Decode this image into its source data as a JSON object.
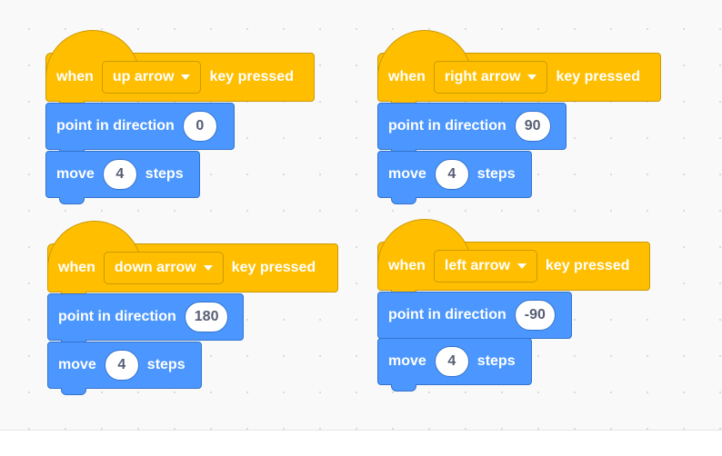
{
  "colors": {
    "events": "#ffbf00",
    "events_border": "#cc9900",
    "motion": "#4c97ff",
    "motion_border": "#3373cc",
    "reporter_text": "#575e75"
  },
  "scripts": [
    {
      "hat": {
        "when": "when",
        "key": "up arrow",
        "suffix": "key pressed"
      },
      "point": {
        "label": "point in direction",
        "value": "0"
      },
      "move": {
        "label": "move",
        "value": "4",
        "suffix": "steps"
      }
    },
    {
      "hat": {
        "when": "when",
        "key": "right arrow",
        "suffix": "key pressed"
      },
      "point": {
        "label": "point in direction",
        "value": "90"
      },
      "move": {
        "label": "move",
        "value": "4",
        "suffix": "steps"
      }
    },
    {
      "hat": {
        "when": "when",
        "key": "down arrow",
        "suffix": "key pressed"
      },
      "point": {
        "label": "point in direction",
        "value": "180"
      },
      "move": {
        "label": "move",
        "value": "4",
        "suffix": "steps"
      }
    },
    {
      "hat": {
        "when": "when",
        "key": "left arrow",
        "suffix": "key pressed"
      },
      "point": {
        "label": "point in direction",
        "value": "-90"
      },
      "move": {
        "label": "move",
        "value": "4",
        "suffix": "steps"
      }
    }
  ]
}
